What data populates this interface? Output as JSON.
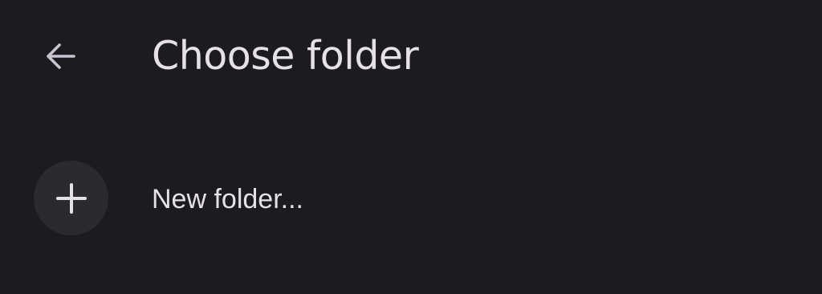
{
  "header": {
    "title": "Choose folder",
    "back_icon": "arrow-back-icon"
  },
  "actions": {
    "new_folder_label": "New folder...",
    "new_folder_icon": "plus-icon"
  },
  "colors": {
    "background": "#1c1b1f",
    "text": "#e6e1e5",
    "icon": "#cac4d0",
    "circle": "#2b2a2f"
  }
}
